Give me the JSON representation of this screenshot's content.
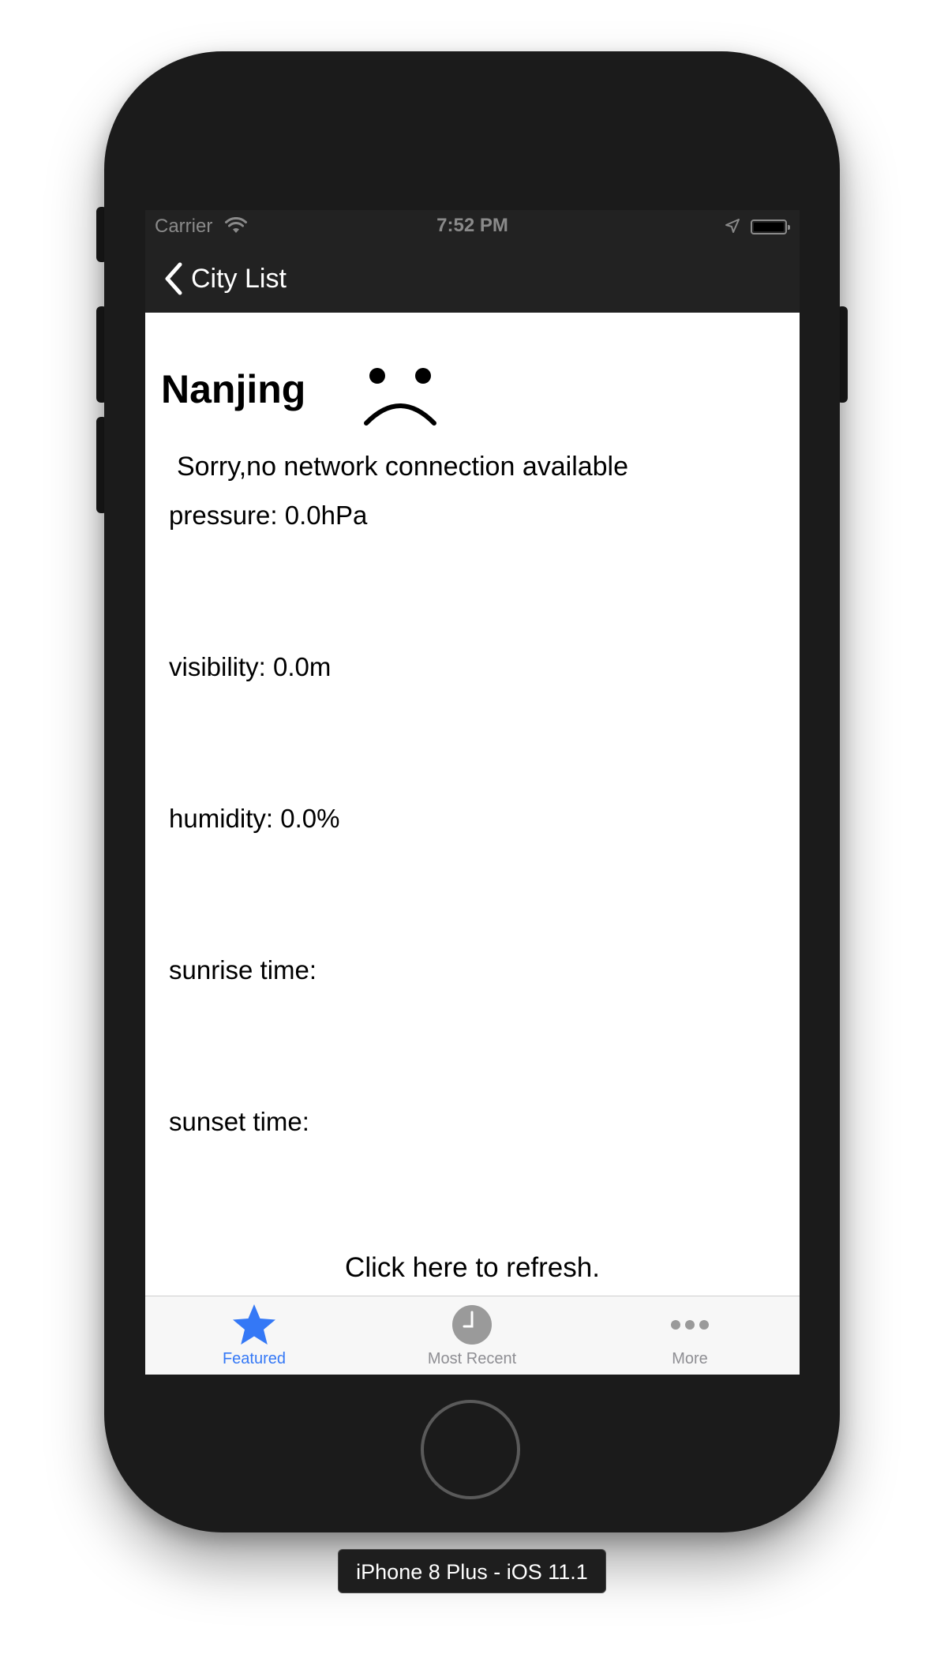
{
  "status_bar": {
    "carrier": "Carrier",
    "time": "7:52 PM",
    "icons": [
      "wifi-icon",
      "location-arrow-icon",
      "battery-icon"
    ]
  },
  "nav": {
    "back_label": "City List",
    "back_icon": "chevron-left-icon"
  },
  "weather": {
    "city": "Nanjing",
    "status_icon": "sad-face-icon",
    "error_message": "Sorry,no network connection available",
    "pressure": "pressure: 0.0hPa",
    "visibility": "visibility: 0.0m",
    "humidity": "humidity: 0.0%",
    "sunrise": "sunrise time:",
    "sunset": "sunset time:",
    "refresh_label": "Click here to refresh."
  },
  "tabbar": {
    "tabs": [
      {
        "label": "Featured",
        "icon": "star-icon",
        "selected": true
      },
      {
        "label": "Most Recent",
        "icon": "clock-icon",
        "selected": false
      },
      {
        "label": "More",
        "icon": "more-dots-icon",
        "selected": false
      }
    ],
    "active_color": "#3478f6",
    "inactive_color": "#8e8e93"
  },
  "device": {
    "label": "iPhone 8 Plus - iOS 11.1"
  }
}
